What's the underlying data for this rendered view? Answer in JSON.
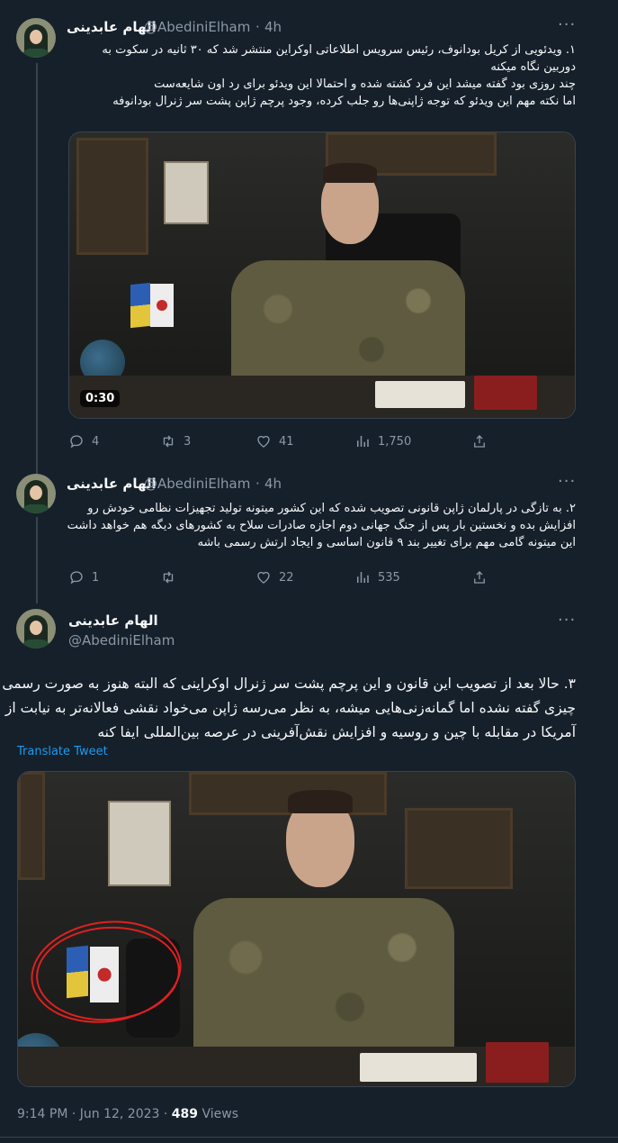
{
  "author": {
    "name": "الهام عابدینی",
    "handle": "@AbediniElham"
  },
  "tweets": [
    {
      "time": "4h",
      "lines": [
        "۱. ویدئویی از کریل بودانوف، رئیس سرویس اطلاعاتی اوکراین منتشر شد که ۳۰ ثانیه در سکوت به",
        "دوربین نگاه میکنه",
        "چند روزی بود گفته میشد این فرد کشته شده و احتمالا این ویدئو برای رد اون شایعه‌ست",
        "اما نکته مهم این ویدئو که توجه ژاپنی‌ها رو جلب کرده، وجود پرچم ژاپن پشت سر ژنرال بودانوفه"
      ],
      "video_duration": "0:30",
      "stats": {
        "replies": "4",
        "retweets": "3",
        "likes": "41",
        "views": "1,750"
      }
    },
    {
      "time": "4h",
      "lines": [
        "۲. به تازگی در پارلمان ژاپن قانونی تصویب شده که این کشور میتونه تولید تجهیزات نظامی خودش رو",
        "افزایش بده و نخستین بار پس از جنگ جهانی دوم اجازه صادرات سلاح به کشورهای دیگه هم خواهد داشت",
        "این میتونه گامی مهم برای تغییر بند ۹ قانون اساسی و ایجاد ارتش رسمی باشه"
      ],
      "stats": {
        "replies": "1",
        "retweets": "",
        "likes": "22",
        "views": "535"
      }
    },
    {
      "lines": [
        "۳. حالا بعد از تصویب این قانون و این پرچم پشت سر ژنرال اوکراینی که البته هنوز به صورت رسمی",
        "چیزی گفته نشده اما گمانه‌زنی‌هایی میشه، به نظر می‌رسه ژاپن می‌خواد نقشی فعالانه‌تر به نیابت از",
        "آمریکا در مقابله با چین و روسیه و افزایش نقش‌آفرینی در عرصه بین‌المللی ایفا کنه"
      ],
      "translate_label": "Translate Tweet",
      "timestamp": "9:14 PM · Jun 12, 2023 · ",
      "views_count": "489",
      "views_label": " Views"
    }
  ],
  "more_label": "···",
  "dot_sep": "·",
  "icons": {
    "reply": "reply-icon",
    "retweet": "retweet-icon",
    "like": "heart-icon",
    "views": "views-icon",
    "share": "share-icon"
  }
}
